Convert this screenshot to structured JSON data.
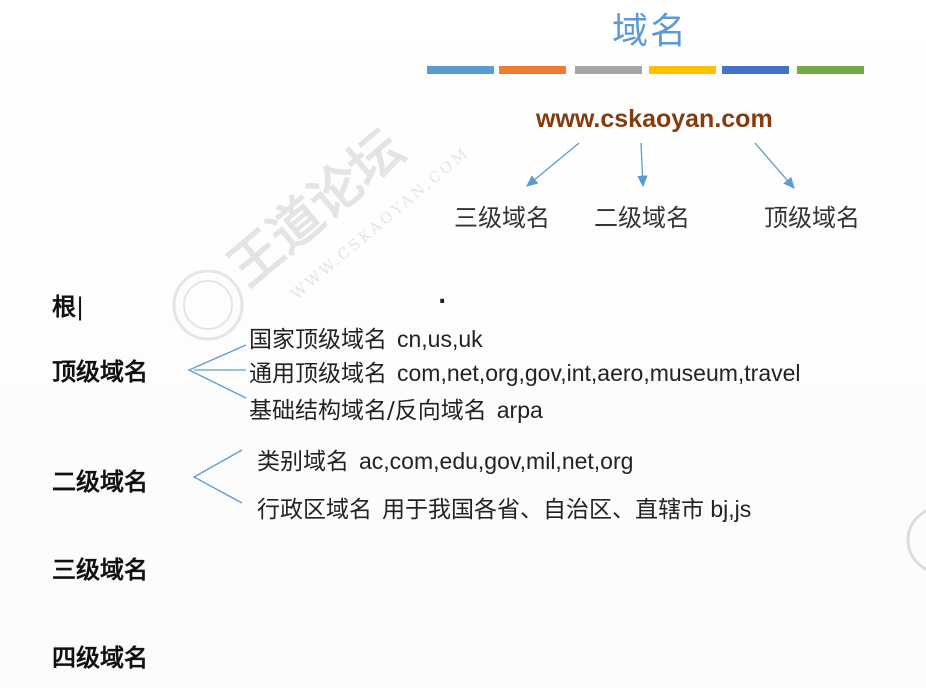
{
  "slide": {
    "title": "域名",
    "colors": {
      "title": "#5b9bd5",
      "url": "#843c0c",
      "arrows": "#5b9bd5",
      "bar": [
        "#5b9bd5",
        "#ed7d31",
        "#a5a5a5",
        "#ffc000",
        "#4472c4",
        "#70ad47"
      ]
    },
    "example_url": "www.cskaoyan.com",
    "url_parts": [
      "三级域名",
      "二级域名",
      "顶级域名"
    ],
    "levels": {
      "root": "根",
      "root_symbol": ".",
      "top": "顶级域名",
      "second": "二级域名",
      "third": "三级域名",
      "fourth": "四级域名"
    },
    "top_level_items": [
      {
        "label": "国家顶级域名",
        "value": "cn,us,uk"
      },
      {
        "label": "通用顶级域名",
        "value": "com,net,org,gov,int,aero,museum,travel"
      },
      {
        "label": "基础结构域名/反向域名",
        "value": "arpa"
      }
    ],
    "second_level_items": [
      {
        "label": "类别域名",
        "value": "ac,com,edu,gov,mil,net,org"
      },
      {
        "label": "行政区域名",
        "value": "用于我国各省、自治区、直辖市 bj,js"
      }
    ],
    "watermark": {
      "text_cn": "王道论坛",
      "text_en": "WWW.CSKAOYAN.COM"
    }
  }
}
